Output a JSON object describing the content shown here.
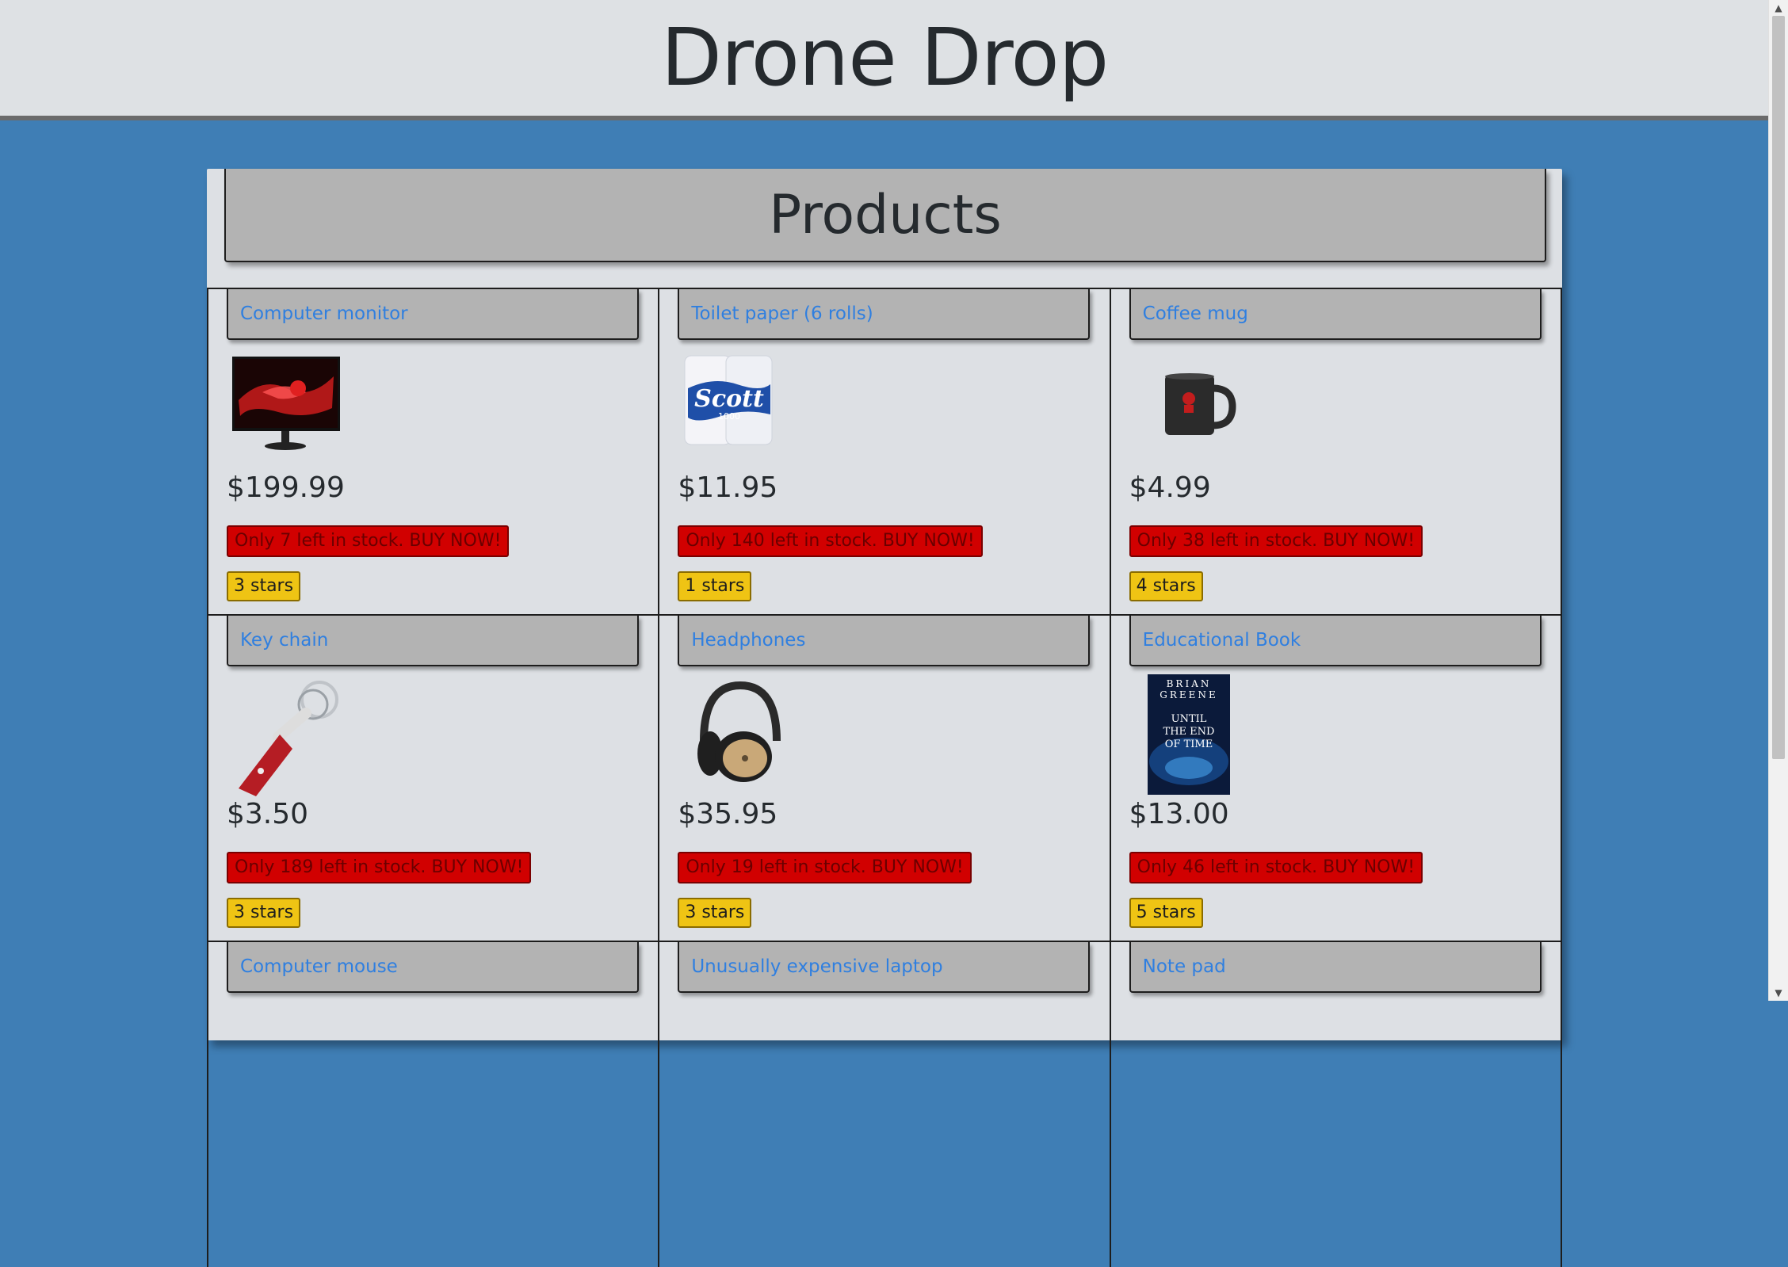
{
  "header": {
    "title": "Drone Drop"
  },
  "products_section": {
    "heading": "Products"
  },
  "products": [
    {
      "name": "Computer monitor",
      "price": "$199.99",
      "stock": "Only 7 left in stock. BUY NOW!",
      "stars": "3 stars",
      "icon": "computer-monitor"
    },
    {
      "name": "Toilet paper (6 rolls)",
      "price": "$11.95",
      "stock": "Only 140 left in stock. BUY NOW!",
      "stars": "1 stars",
      "icon": "toilet-paper"
    },
    {
      "name": "Coffee mug",
      "price": "$4.99",
      "stock": "Only 38 left in stock. BUY NOW!",
      "stars": "4 stars",
      "icon": "coffee-mug"
    },
    {
      "name": "Key chain",
      "price": "$3.50",
      "stock": "Only 189 left in stock. BUY NOW!",
      "stars": "3 stars",
      "icon": "key-chain"
    },
    {
      "name": "Headphones",
      "price": "$35.95",
      "stock": "Only 19 left in stock. BUY NOW!",
      "stars": "3 stars",
      "icon": "headphones"
    },
    {
      "name": "Educational Book",
      "price": "$13.00",
      "stock": "Only 46 left in stock. BUY NOW!",
      "stars": "5 stars",
      "icon": "book",
      "book_cover": {
        "author_line1": "BRIAN",
        "author_line2": "GREENE",
        "title_line1": "UNTIL",
        "title_line2": "THE END",
        "title_line3": "OF TIME"
      }
    },
    {
      "name": "Computer mouse"
    },
    {
      "name": "Unusually expensive laptop"
    },
    {
      "name": "Note pad"
    }
  ],
  "colors": {
    "background": "#3f7eb5",
    "link": "#2f7fe0",
    "stock_badge": "#d10000",
    "stars_badge": "#efc414"
  }
}
